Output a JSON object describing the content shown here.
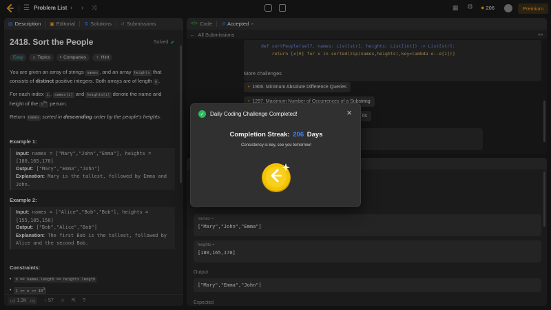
{
  "header": {
    "problem_list": "Problem List",
    "streak_count": "206",
    "premium": "Premium"
  },
  "left": {
    "tabs": {
      "description": "Description",
      "editorial": "Editorial",
      "solutions": "Solutions",
      "submissions": "Submissions"
    },
    "title": "2418. Sort the People",
    "solved": "Solved",
    "chips": {
      "difficulty": "Easy",
      "topics": "Topics",
      "companies": "Companies",
      "hint": "Hint"
    },
    "p1": {
      "a": "You are given an array of strings ",
      "c1": "names",
      "b": ", and an array ",
      "c2": "heights",
      "c": " that consists of ",
      "d": "distinct",
      "e": " positive integers. Both arrays are of length ",
      "c3": "n",
      "f": "."
    },
    "p2": {
      "a": "For each index ",
      "c1": "i",
      "b": ", ",
      "c2": "names[i]",
      "c": " and ",
      "c3": "heights[i]",
      "d": " denote the name and height of the ",
      "c4": "i",
      "sup": "th",
      "e": " person."
    },
    "p3": {
      "a": "Return ",
      "c1": "names",
      "b": " sorted in ",
      "d": "descending",
      "e": " order by the people's heights."
    },
    "ex1": {
      "title": "Example 1:",
      "input_label": "Input:",
      "input": "names = [\"Mary\",\"John\",\"Emma\"], heights = [180,165,170]",
      "output_label": "Output:",
      "output": "[\"Mary\",\"Emma\",\"John\"]",
      "expl_label": "Explanation:",
      "expl": "Mary is the tallest, followed by Emma and John."
    },
    "ex2": {
      "title": "Example 2:",
      "input_label": "Input:",
      "input": "names = [\"Alice\",\"Bob\",\"Bob\"], heights = [155,185,150]",
      "output_label": "Output:",
      "output": "[\"Bob\",\"Alice\",\"Bob\"]",
      "expl_label": "Explanation:",
      "expl": "The first Bob is the tallest, followed by Alice and the second Bob."
    },
    "constraints": {
      "title": "Constraints:",
      "c1": "n == names.length == heights.length",
      "c2": "1 <= n <= 10",
      "c2_sup": "3"
    },
    "footer": {
      "likes": "1.3K",
      "comments": "57"
    }
  },
  "right": {
    "tabs": {
      "code": "Code",
      "accepted": "Accepted"
    },
    "all_submissions": "All Submissions",
    "code_line1": "def sortPeople(self, names: List[str], heights: List[int]) -> List[str]:",
    "code_line2": "    return [x[0] for x in sorted(zip(names,heights),key=lambda e:-e[1])]",
    "more_title": "More challenges",
    "challenges": [
      "1906. Minimum Absolute Difference Queries",
      "1297. Maximum Number of Occurrences of a Substring",
      "its"
    ],
    "input_label": "Input",
    "names_label": "names =",
    "names_value": "[\"Mary\",\"John\",\"Emma\"]",
    "heights_label": "heights =",
    "heights_value": "[180,165,170]",
    "output_label": "Output",
    "output_value": "[\"Mary\",\"Emma\",\"John\"]",
    "expected_label": "Expected"
  },
  "modal": {
    "title": "Daily Coding Challenge Completed!",
    "streak_label": "Completion Streak:",
    "streak_value": "206",
    "streak_unit": "Days",
    "subtitle": "Consistency is key, see you tomorrow!"
  },
  "colors": {
    "accent_green": "#2cbb5d",
    "accent_blue": "#3b82f6",
    "easy": "#2cbbc0",
    "gold": "#f5c400",
    "orange": "#f59e0b"
  }
}
